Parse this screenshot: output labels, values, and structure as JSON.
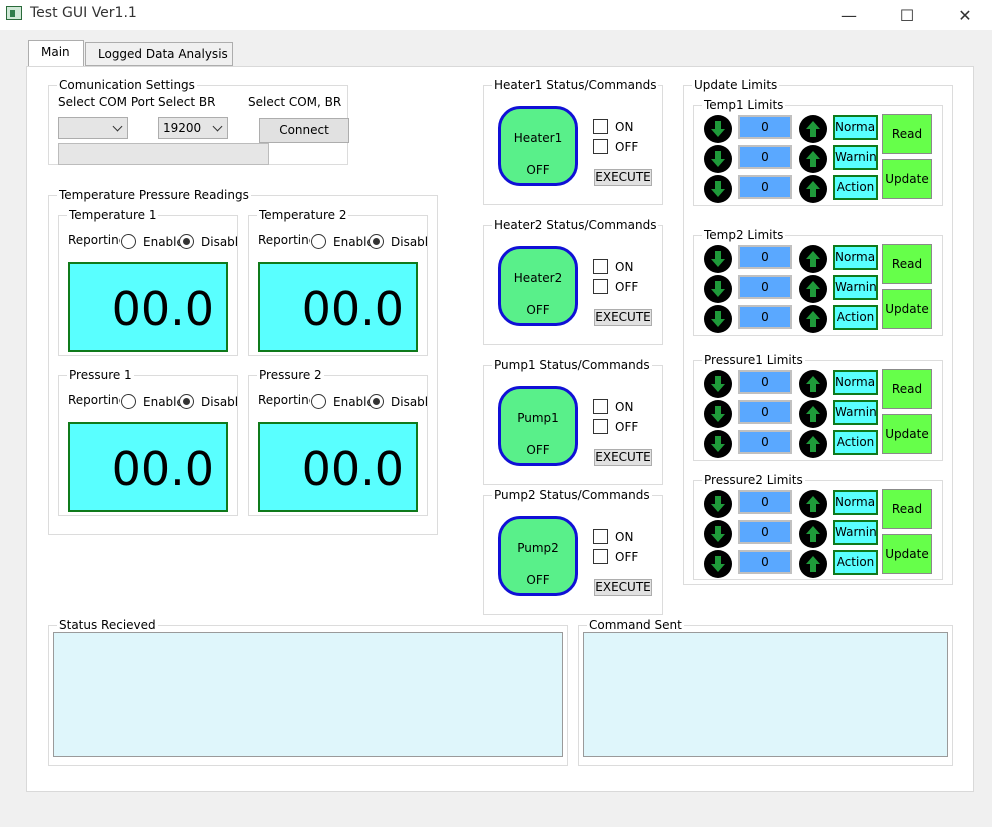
{
  "window": {
    "title": "Test GUI Ver1.1",
    "minimize": "—",
    "maximize": "☐",
    "close": "✕"
  },
  "tabs": [
    {
      "label": "Main"
    },
    {
      "label": "Logged Data Analysis"
    }
  ],
  "comm": {
    "title": "Comunication Settings",
    "port_label": "Select COM Port",
    "br_label": "Select BR",
    "select_label": "Select COM, BR",
    "port_value": "",
    "br_value": "19200",
    "connect": "Connect"
  },
  "readings": {
    "title": "Temperature  Pressure Readings",
    "reporting": "Reporting",
    "enable": "Enable",
    "disable": "Disable",
    "panels": [
      {
        "title": "Temperature 1",
        "value": "00.0"
      },
      {
        "title": "Temperature 2",
        "value": "00.0"
      },
      {
        "title": "Pressure 1",
        "value": "00.0"
      },
      {
        "title": "Pressure 2",
        "value": "00.0"
      }
    ]
  },
  "devices": [
    {
      "title": "Heater1 Status/Commands",
      "name": "Heater1",
      "state": "OFF"
    },
    {
      "title": "Heater2 Status/Commands",
      "name": "Heater2",
      "state": "OFF"
    },
    {
      "title": "Pump1 Status/Commands",
      "name": "Pump1",
      "state": "OFF"
    },
    {
      "title": "Pump2 Status/Commands",
      "name": "Pump2",
      "state": "OFF"
    }
  ],
  "device_labels": {
    "on": "ON",
    "off": "OFF",
    "execute": "EXECUTE"
  },
  "limits": {
    "title": "Update Limits",
    "read": "Read",
    "update": "Update",
    "levels": [
      "Normal",
      "Warning",
      "Action"
    ],
    "groups": [
      {
        "title": "Temp1 Limits",
        "values": [
          "0",
          "0",
          "0"
        ]
      },
      {
        "title": "Temp2 Limits",
        "values": [
          "0",
          "0",
          "0"
        ]
      },
      {
        "title": "Pressure1 Limits",
        "values": [
          "0",
          "0",
          "0"
        ]
      },
      {
        "title": "Pressure2 Limits",
        "values": [
          "0",
          "0",
          "0"
        ]
      }
    ]
  },
  "status": {
    "received_title": "Status Recieved",
    "sent_title": "Command Sent"
  },
  "colors": {
    "display": "#59ffff",
    "status_on": "#59f08a",
    "value_box": "#5aa8ff",
    "action_button": "#66ff4a"
  }
}
